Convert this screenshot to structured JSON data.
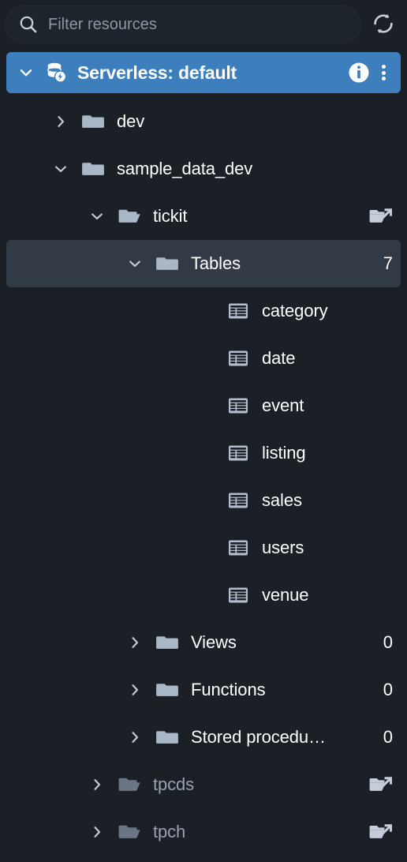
{
  "search": {
    "placeholder": "Filter resources",
    "value": "",
    "icon": "search-icon",
    "refresh_icon": "refresh-icon"
  },
  "connection": {
    "caret_icon": "chevron-down-icon",
    "db_icon": "serverless-database-icon",
    "title": "Serverless: default",
    "info_icon": "info-circle-icon",
    "menu_icon": "kebab-menu-icon",
    "accent_color": "#3d7fbc"
  },
  "colors": {
    "background": "#1b2027",
    "selected_row": "#323a46",
    "accent": "#3d7fbc",
    "icon_gray": "#aab7c6",
    "text": "#ffffff",
    "dim_text": "#98a2b0"
  },
  "tree": [
    {
      "label": "dev",
      "indent": "ind-1",
      "twisty": "chevron-right-icon",
      "icon": "folder-icon",
      "count": "",
      "action": "",
      "selected": false,
      "dim": false
    },
    {
      "label": "sample_data_dev",
      "indent": "ind-1",
      "twisty": "chevron-down-icon",
      "icon": "folder-icon",
      "count": "",
      "action": "",
      "selected": false,
      "dim": false
    },
    {
      "label": "tickit",
      "indent": "ind-2",
      "twisty": "chevron-down-icon",
      "icon": "folder-open-icon",
      "count": "",
      "action": "folder-share-icon",
      "selected": false,
      "dim": false
    },
    {
      "label": "Tables",
      "indent": "ind-3",
      "twisty": "chevron-down-icon",
      "icon": "folder-icon",
      "count": "7",
      "action": "",
      "selected": true,
      "dim": false
    },
    {
      "label": "category",
      "indent": "ind-leaf",
      "twisty": "",
      "icon": "table-icon",
      "count": "",
      "action": "",
      "selected": false,
      "dim": false
    },
    {
      "label": "date",
      "indent": "ind-leaf",
      "twisty": "",
      "icon": "table-icon",
      "count": "",
      "action": "",
      "selected": false,
      "dim": false
    },
    {
      "label": "event",
      "indent": "ind-leaf",
      "twisty": "",
      "icon": "table-icon",
      "count": "",
      "action": "",
      "selected": false,
      "dim": false
    },
    {
      "label": "listing",
      "indent": "ind-leaf",
      "twisty": "",
      "icon": "table-icon",
      "count": "",
      "action": "",
      "selected": false,
      "dim": false
    },
    {
      "label": "sales",
      "indent": "ind-leaf",
      "twisty": "",
      "icon": "table-icon",
      "count": "",
      "action": "",
      "selected": false,
      "dim": false
    },
    {
      "label": "users",
      "indent": "ind-leaf",
      "twisty": "",
      "icon": "table-icon",
      "count": "",
      "action": "",
      "selected": false,
      "dim": false
    },
    {
      "label": "venue",
      "indent": "ind-leaf",
      "twisty": "",
      "icon": "table-icon",
      "count": "",
      "action": "",
      "selected": false,
      "dim": false
    },
    {
      "label": "Views",
      "indent": "ind-3",
      "twisty": "chevron-right-icon",
      "icon": "folder-icon",
      "count": "0",
      "action": "",
      "selected": false,
      "dim": false
    },
    {
      "label": "Functions",
      "indent": "ind-3",
      "twisty": "chevron-right-icon",
      "icon": "folder-icon",
      "count": "0",
      "action": "",
      "selected": false,
      "dim": false
    },
    {
      "label": "Stored procedu…",
      "indent": "ind-3",
      "twisty": "chevron-right-icon",
      "icon": "folder-icon",
      "count": "0",
      "action": "",
      "selected": false,
      "dim": false
    },
    {
      "label": "tpcds",
      "indent": "ind-2",
      "twisty": "chevron-right-icon",
      "icon": "folder-open-icon",
      "count": "",
      "action": "folder-share-icon",
      "selected": false,
      "dim": true
    },
    {
      "label": "tpch",
      "indent": "ind-2",
      "twisty": "chevron-right-icon",
      "icon": "folder-open-icon",
      "count": "",
      "action": "folder-share-icon",
      "selected": false,
      "dim": true
    }
  ]
}
